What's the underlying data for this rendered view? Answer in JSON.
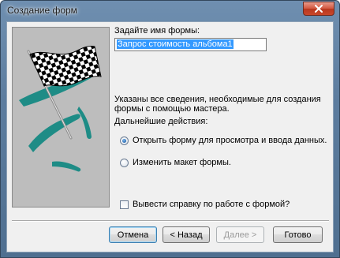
{
  "window": {
    "title": "Создание форм"
  },
  "form_name": {
    "label": "Задайте имя формы:",
    "value": "Запрос стоимость альбома1"
  },
  "info": {
    "line1": "Указаны все сведения, необходимые для создания",
    "line2": "формы с помощью мастера.",
    "next_actions_label": "Дальнейшие действия:"
  },
  "options": [
    {
      "label": "Открыть форму для просмотра и ввода данных.",
      "checked": true
    },
    {
      "label": "Изменить макет формы.",
      "checked": false
    }
  ],
  "help_checkbox": {
    "label": "Вывести справку по работе с формой?",
    "checked": false
  },
  "buttons": {
    "cancel": "Отмена",
    "back": "< Назад",
    "next": "Далее >",
    "finish": "Готово"
  },
  "colors": {
    "accent_teal": "#1e8c86",
    "selection": "#3399ff"
  }
}
